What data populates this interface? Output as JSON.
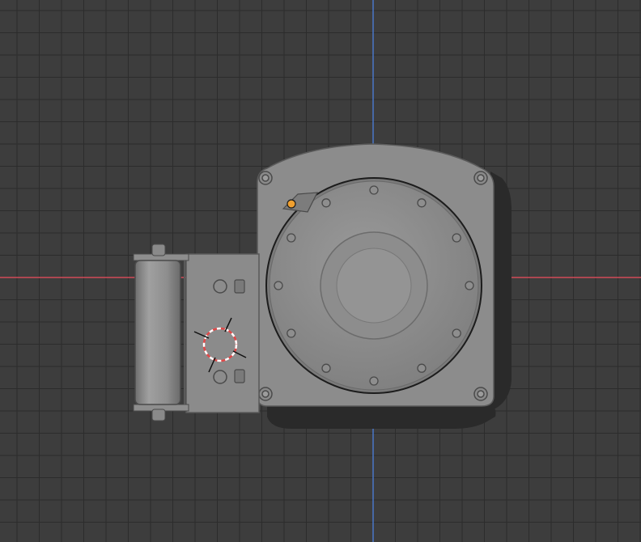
{
  "viewport": {
    "background": "#3d3d3d",
    "grid_color": "#2c2c2c",
    "x_axis_color": "#d24b58",
    "y_axis_color": "#4a77c8"
  },
  "model": {
    "body_color": "#8c8c8c",
    "shadow_color": "#2a2a2a",
    "origin_point_color": "#f0a030",
    "cursor_color_a": "#e04848",
    "cursor_color_b": "#ffffff",
    "icons": {
      "object_origin": "object-origin-icon",
      "cursor_3d": "3d-cursor-icon"
    }
  }
}
